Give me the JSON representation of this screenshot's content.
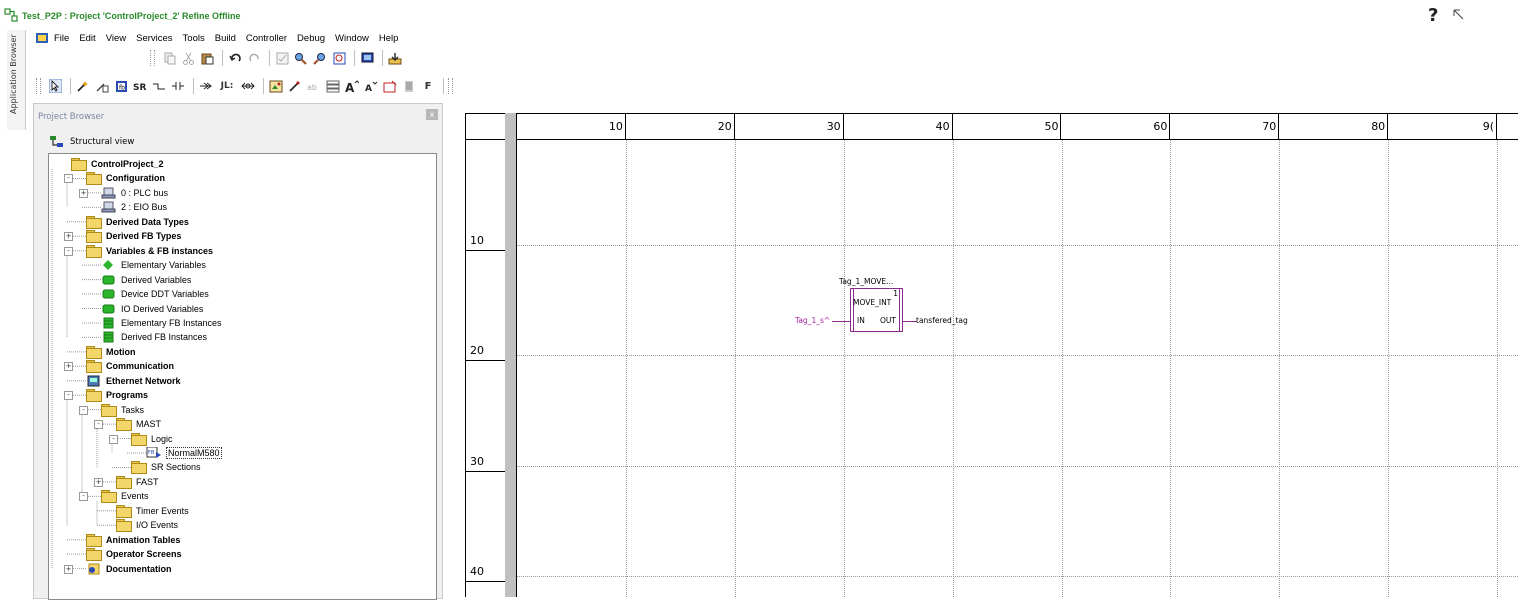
{
  "window": {
    "title": "Test_P2P : Project 'ControlProject_2' Refine Offline",
    "help_glyph": "?"
  },
  "side_tab": {
    "label": "Application Browser"
  },
  "menu": {
    "items": [
      "File",
      "Edit",
      "View",
      "Services",
      "Tools",
      "Build",
      "Controller",
      "Debug",
      "Window",
      "Help"
    ]
  },
  "toolbar2": {
    "f_label": "F",
    "jl_label": "JL:"
  },
  "project_browser": {
    "title": "Project Browser",
    "close_glyph": "x",
    "view_label": "Structural view",
    "tree": [
      {
        "label": "ControlProject_2",
        "bold": true
      },
      {
        "label": "Configuration",
        "bold": true
      },
      {
        "label": "0 : PLC bus",
        "bold": false
      },
      {
        "label": "2 : EIO Bus",
        "bold": false
      },
      {
        "label": "Derived Data Types",
        "bold": true
      },
      {
        "label": "Derived FB Types",
        "bold": true
      },
      {
        "label": "Variables & FB instances",
        "bold": true
      },
      {
        "label": "Elementary Variables",
        "bold": false
      },
      {
        "label": "Derived Variables",
        "bold": false
      },
      {
        "label": "Device DDT Variables",
        "bold": false
      },
      {
        "label": "IO Derived Variables",
        "bold": false
      },
      {
        "label": "Elementary FB Instances",
        "bold": false
      },
      {
        "label": "Derived FB Instances",
        "bold": false
      },
      {
        "label": "Motion",
        "bold": true
      },
      {
        "label": "Communication",
        "bold": true
      },
      {
        "label": "Ethernet Network",
        "bold": true
      },
      {
        "label": "Programs",
        "bold": true
      },
      {
        "label": "Tasks",
        "bold": false
      },
      {
        "label": "MAST",
        "bold": false
      },
      {
        "label": "Logic",
        "bold": false
      },
      {
        "label": "NormalM580",
        "bold": false,
        "selected": true
      },
      {
        "label": "SR Sections",
        "bold": false
      },
      {
        "label": "FAST",
        "bold": false
      },
      {
        "label": "Events",
        "bold": false
      },
      {
        "label": "Timer Events",
        "bold": false
      },
      {
        "label": "I/O Events",
        "bold": false
      },
      {
        "label": "Animation Tables",
        "bold": true
      },
      {
        "label": "Operator Screens",
        "bold": true
      },
      {
        "label": "Documentation",
        "bold": true
      }
    ]
  },
  "editor": {
    "column_labels": [
      "10",
      "20",
      "30",
      "40",
      "50",
      "60",
      "70",
      "80",
      "9("
    ],
    "row_labels": [
      "10",
      "20",
      "30",
      "40"
    ],
    "block": {
      "instance_name": "Tag_1_MOVE...",
      "exec_number": "1",
      "type_name": "MOVE_INT",
      "input_pin": "IN",
      "output_pin": "OUT",
      "input_var": "Tag_1_s^",
      "output_var": "tansfered_tag"
    }
  },
  "colors": {
    "title_green": "#2a8a2a",
    "block_purple": "#8a2a8a",
    "folder_yellow": "#f2d66a",
    "ruler_gray": "#c0c0c0"
  }
}
